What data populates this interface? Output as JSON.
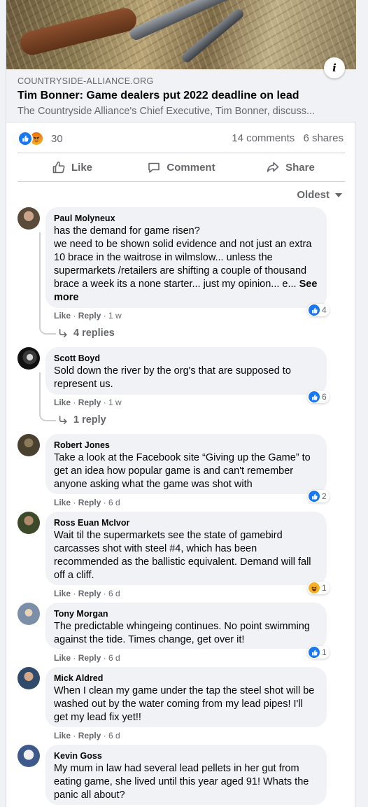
{
  "link_preview": {
    "domain": "COUNTRYSIDE-ALLIANCE.ORG",
    "title": "Tim Bonner: Game dealers put 2022 deadline on lead",
    "description": "The Countryside Alliance's Chief Executive, Tim Bonner, discuss..."
  },
  "post_stats": {
    "reaction_count": "30",
    "comments": "14 comments",
    "shares": "6 shares"
  },
  "actions": {
    "like": "Like",
    "comment": "Comment",
    "share": "Share"
  },
  "sort": {
    "label": "Oldest"
  },
  "colors": {
    "accent": "#1877f2",
    "meta": "#65676b",
    "bubble": "#f0f2f5"
  },
  "comments": [
    {
      "author": "Paul Molyneux",
      "text": "has the demand for game risen?\nwe need to be shown solid evidence and not just an extra 10 brace in the waitrose in wilmslow... unless the supermarkets /retailers are shifting a couple of thousand brace a week its a none starter... just my opinion... e...",
      "see_more": "See more",
      "like": "Like",
      "reply": "Reply",
      "time": "1 w",
      "reaction_count": "4",
      "reaction_type": "like-icon",
      "replies": "4 replies"
    },
    {
      "author": "Scott Boyd",
      "text": "Sold down the river by the org's that are supposed to represent us.",
      "like": "Like",
      "reply": "Reply",
      "time": "1 w",
      "reaction_count": "6",
      "reaction_type": "like-icon",
      "replies": "1 reply"
    },
    {
      "author": "Robert Jones",
      "text": "Take a look at the Facebook site “Giving up the Game” to get an idea how popular game is and can't remember anyone asking what the game was shot with",
      "like": "Like",
      "reply": "Reply",
      "time": "6 d",
      "reaction_count": "2",
      "reaction_type": "like-icon"
    },
    {
      "author": "Ross Euan McIvor",
      "text": "Wait til the supermarkets see the state of gamebird carcasses shot with steel #4, which has been recommended as the ballistic equivalent. Demand will fall off a cliff.",
      "like": "Like",
      "reply": "Reply",
      "time": "6 d",
      "reaction_count": "1",
      "reaction_type": "haha-icon"
    },
    {
      "author": "Tony Morgan",
      "text": "The predictable whingeing continues. No point swimming against the tide. Times change, get over it!",
      "like": "Like",
      "reply": "Reply",
      "time": "6 d",
      "reaction_count": "1",
      "reaction_type": "like-icon"
    },
    {
      "author": "Mick Aldred",
      "text": "When I clean my game under the tap the steel shot will be washed out by the water coming from my lead pipes! I'll get my lead fix yet!!",
      "like": "Like",
      "reply": "Reply",
      "time": "6 d"
    },
    {
      "author": "Kevin Goss",
      "text": "My mum in law had several lead pellets in her gut from eating game, she lived until this year aged 91! Whats the panic all about?"
    }
  ]
}
